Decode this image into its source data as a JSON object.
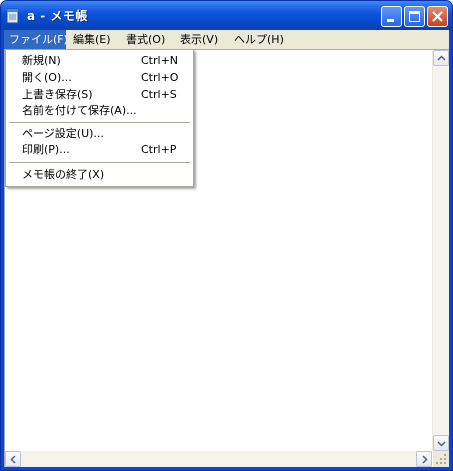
{
  "window": {
    "title": "a - メモ帳"
  },
  "menubar": {
    "items": [
      {
        "label": "ファイル(F)"
      },
      {
        "label": "編集(E)"
      },
      {
        "label": "書式(O)"
      },
      {
        "label": "表示(V)"
      },
      {
        "label": "ヘルプ(H)"
      }
    ]
  },
  "file_menu": {
    "items": [
      {
        "label": "新規(N)",
        "shortcut": "Ctrl+N"
      },
      {
        "label": "開く(O)...",
        "shortcut": "Ctrl+O"
      },
      {
        "label": "上書き保存(S)",
        "shortcut": "Ctrl+S"
      },
      {
        "label": "名前を付けて保存(A)...",
        "shortcut": ""
      },
      {
        "label": "ページ設定(U)...",
        "shortcut": ""
      },
      {
        "label": "印刷(P)...",
        "shortcut": "Ctrl+P"
      },
      {
        "label": "メモ帳の終了(X)",
        "shortcut": ""
      }
    ]
  },
  "colors": {
    "titlebar": "#0a52d8",
    "menu_highlight": "#316ac5",
    "close_button": "#c8401d"
  }
}
